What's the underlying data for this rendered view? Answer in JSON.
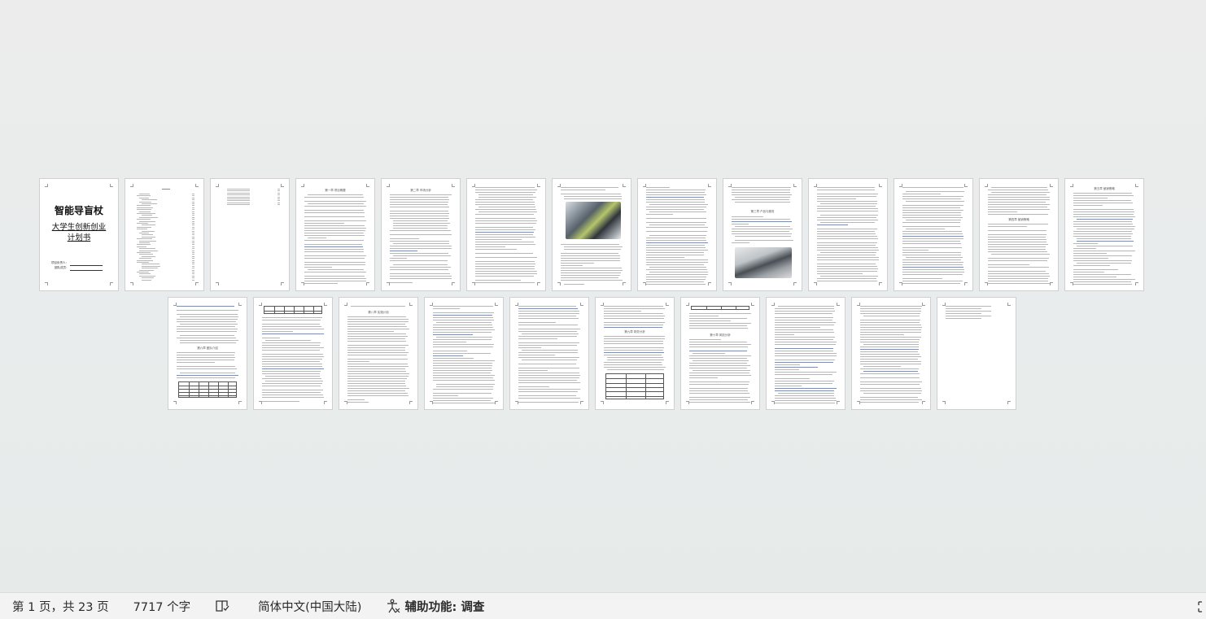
{
  "cover": {
    "title": "智能导盲杖",
    "subtitle_line1": "大学生创新创业",
    "subtitle_line2": "计划书",
    "field_leader": "项目负责人：",
    "field_team": "团队成员："
  },
  "page_headings": {
    "p4": "第一章 项目概要",
    "p5": "第二章 市场分析",
    "p8": "第三章 产品与服务",
    "p10": "第四章 营销策略",
    "p14": "第五章 营销策略",
    "p15": "第六章 团队介绍",
    "p16": "第七章 团队介绍",
    "p18": "第八章 实施计划",
    "p21": "第九章 财务分析",
    "p22": "第十章 风险分析"
  },
  "status_bar": {
    "page_info": "第 1 页，共 23 页",
    "word_count": "7717 个字",
    "language": "简体中文(中国大陆)",
    "accessibility": "辅助功能: 调查"
  },
  "view": {
    "total_pages": 23
  }
}
